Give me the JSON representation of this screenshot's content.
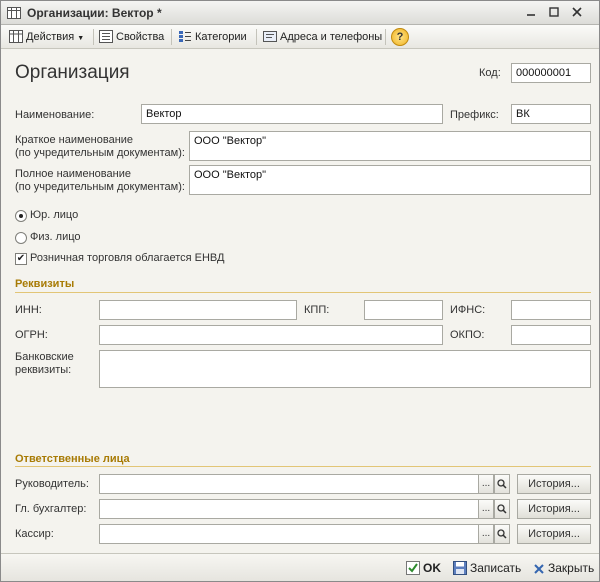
{
  "window": {
    "title": "Организации: Вектор *"
  },
  "toolbar": {
    "actions_label": "Действия",
    "properties_label": "Свойства",
    "categories_label": "Категории",
    "addresses_label": "Адреса и телефоны",
    "help_label": "?"
  },
  "form": {
    "heading": "Организация",
    "code_label": "Код:",
    "code_value": "000000001",
    "name_label": "Наименование:",
    "name_value": "Вектор",
    "prefix_label": "Префикс:",
    "prefix_value": "ВК",
    "short_name_label_1": "Краткое наименование",
    "short_name_label_2": "(по учредительным документам):",
    "short_name_value": "ООО \"Вектор\"",
    "full_name_label_1": "Полное наименование",
    "full_name_label_2": "(по учредительным документам):",
    "full_name_value": "ООО \"Вектор\"",
    "legal_entity_label": "Юр. лицо",
    "individual_label": "Физ. лицо",
    "envd_label": "Розничная торговля облагается ЕНВД",
    "legal_entity_selected": true,
    "envd_checked": true
  },
  "requisites": {
    "section_title": "Реквизиты",
    "inn_label": "ИНН:",
    "inn_value": "",
    "kpp_label": "КПП:",
    "kpp_value": "",
    "ifns_label": "ИФНС:",
    "ifns_value": "",
    "ogrn_label": "ОГРН:",
    "ogrn_value": "",
    "okpo_label": "ОКПО:",
    "okpo_value": "",
    "bank_label_1": "Банковские",
    "bank_label_2": "реквизиты:",
    "bank_value": ""
  },
  "responsible": {
    "section_title": "Ответственные лица",
    "select_label": "...",
    "history_label": "История...",
    "rows": [
      {
        "label": "Руководитель:",
        "value": ""
      },
      {
        "label": "Гл. бухгалтер:",
        "value": ""
      },
      {
        "label": "Кассир:",
        "value": ""
      }
    ]
  },
  "bottombar": {
    "ok_label": "OK",
    "save_label": "Записать",
    "close_label": "Закрыть"
  },
  "colors": {
    "section_title": "#a87b05",
    "ok_icon": "#2e8b2e",
    "close_icon": "#3566b0"
  },
  "icons": {
    "title": "table-icon",
    "properties": "properties-icon",
    "categories": "categories-icon",
    "addresses": "address-book-icon",
    "help": "help-icon",
    "search": "magnifier-icon",
    "ok": "checkmark-icon",
    "save": "floppy-icon",
    "close": "close-x-icon"
  }
}
